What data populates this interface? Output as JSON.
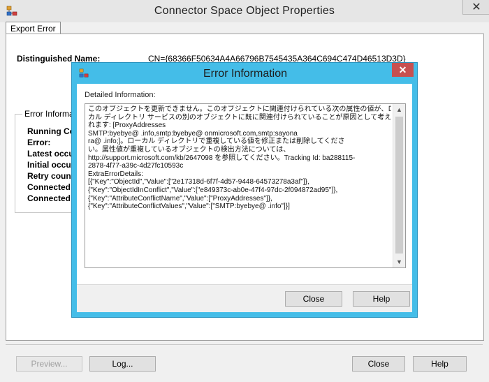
{
  "window": {
    "title": "Connector Space Object Properties",
    "close_glyph": "✕",
    "icon": "app-network-icon"
  },
  "tabs": [
    {
      "label": "Export Error"
    }
  ],
  "object": {
    "dn_label": "Distinguished Name:",
    "dn_value": "CN={68366F50634A4A66796B7545435A364C694C474D46513D3D}"
  },
  "error_group": {
    "title": "Error Information",
    "fields": [
      {
        "label": "Running Connector"
      },
      {
        "label": "Error:"
      },
      {
        "label": "Latest occurrence:"
      },
      {
        "label": "Initial occurrence:"
      },
      {
        "label": "Retry count:"
      },
      {
        "label": "Connected data source"
      },
      {
        "label": "Connected data source element"
      }
    ]
  },
  "footer": {
    "preview_label": "Preview...",
    "log_label": "Log...",
    "close_label": "Close",
    "help_label": "Help"
  },
  "dialog": {
    "title": "Error Information",
    "close_glyph": "✕",
    "detail_label": "Detailed Information:",
    "lines": [
      "このオブジェクトを更新できません。このオブジェクトに関連付けられている次の属性の値が、ロー",
      "カル ディレクトリ サービスの別のオブジェクトに既に関連付けられていることが原因として考えら",
      "れます: [ProxyAddresses",
      "SMTP:byebye@                .info,smtp:byebye@              onmicrosoft.com,smtp:sayona",
      "ra@                   .info;]。ローカル ディレクトリで重複している値を修正または削除してくださ",
      "い。属性値が重複しているオブジェクトの検出方法については、",
      "http://support.microsoft.com/kb/2647098 を参照してください。Tracking Id: ba288115-",
      "2878-4f77-a39c-4d27fc10593c",
      "ExtraErrorDetails:",
      "[{\"Key\":\"ObjectId\",\"Value\":[\"2e17318d-6f7f-4d57-9448-64573278a3af\"]},",
      "{\"Key\":\"ObjectIdInConflict\",\"Value\":[\"e849373c-ab0e-47f4-97dc-2f094872ad95\"]},",
      "{\"Key\":\"AttributeConflictName\",\"Value\":[\"ProxyAddresses\"]},",
      "{\"Key\":\"AttributeConflictValues\",\"Value\":[\"SMTP:byebye@                         .info\"]}]"
    ],
    "close_label": "Close",
    "help_label": "Help"
  }
}
